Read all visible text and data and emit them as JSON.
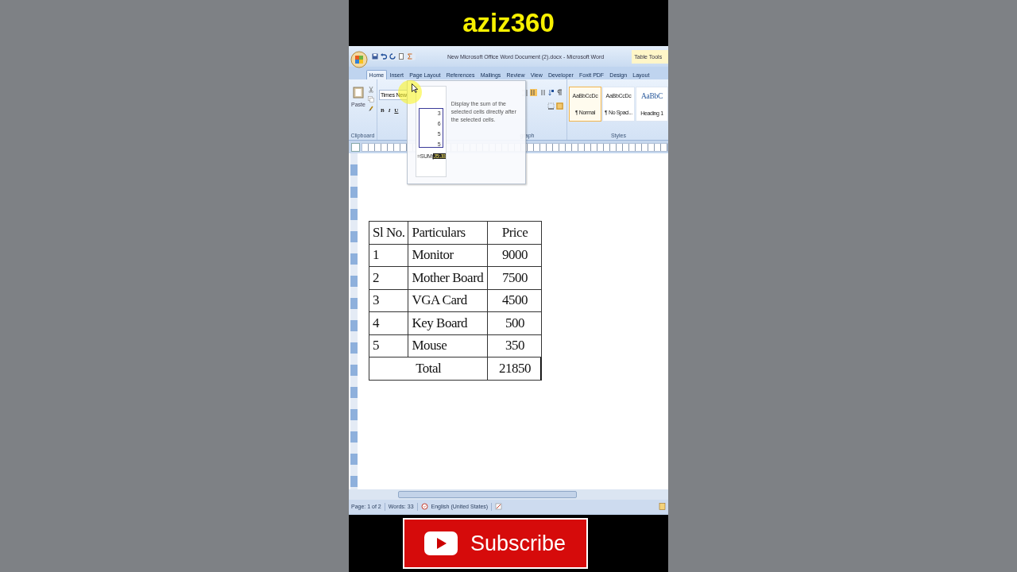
{
  "channel": {
    "name": "aziz360"
  },
  "window": {
    "title": "New Microsoft Office Word Document (2).docx - Microsoft Word",
    "context_tab_group": "Table Tools"
  },
  "tabs": [
    {
      "label": "Home",
      "selected": true
    },
    {
      "label": "Insert",
      "selected": false
    },
    {
      "label": "Page Layout",
      "selected": false
    },
    {
      "label": "References",
      "selected": false
    },
    {
      "label": "Mailings",
      "selected": false
    },
    {
      "label": "Review",
      "selected": false
    },
    {
      "label": "View",
      "selected": false
    },
    {
      "label": "Developer",
      "selected": false
    },
    {
      "label": "Foxit PDF",
      "selected": false
    },
    {
      "label": "Design",
      "selected": false
    },
    {
      "label": "Layout",
      "selected": false
    }
  ],
  "ribbon": {
    "paste_label": "Paste",
    "clipboard_label": "Clipboard",
    "font_box": {
      "value": "Times New"
    },
    "format_buttons": [
      "B",
      "I",
      "U"
    ],
    "paragraph_label": "graph",
    "styles_label": "Styles",
    "styles": [
      {
        "preview": "AaBbCcDc",
        "label": "¶ Normal",
        "selected": true,
        "kind": "body"
      },
      {
        "preview": "AaBbCcDc",
        "label": "¶ No Spaci...",
        "selected": false,
        "kind": "body"
      },
      {
        "preview": "AaBbC",
        "label": "Heading 1",
        "selected": false,
        "kind": "heading"
      }
    ]
  },
  "tooltip": {
    "preview_values": [
      "3",
      "6",
      "5",
      "5"
    ],
    "formula": "=SUM(",
    "formula_range": "J5:J8",
    "description": "Display the sum of the selected cells directly after the selected cells."
  },
  "table": {
    "columns": [
      "Sl No.",
      "Particulars",
      "Price"
    ],
    "rows": [
      [
        "1",
        "Monitor",
        "9000"
      ],
      [
        "2",
        "Mother Board",
        "7500"
      ],
      [
        "3",
        "VGA Card",
        "4500"
      ],
      [
        "4",
        "Key Board",
        "500"
      ],
      [
        "5",
        "Mouse",
        "350"
      ]
    ],
    "total": {
      "label": "Total",
      "value": "21850"
    }
  },
  "status_bar": {
    "page": "Page: 1 of 2",
    "words": "Words: 33",
    "language": "English (United States)"
  },
  "subscribe_button": {
    "label": "Subscribe"
  }
}
